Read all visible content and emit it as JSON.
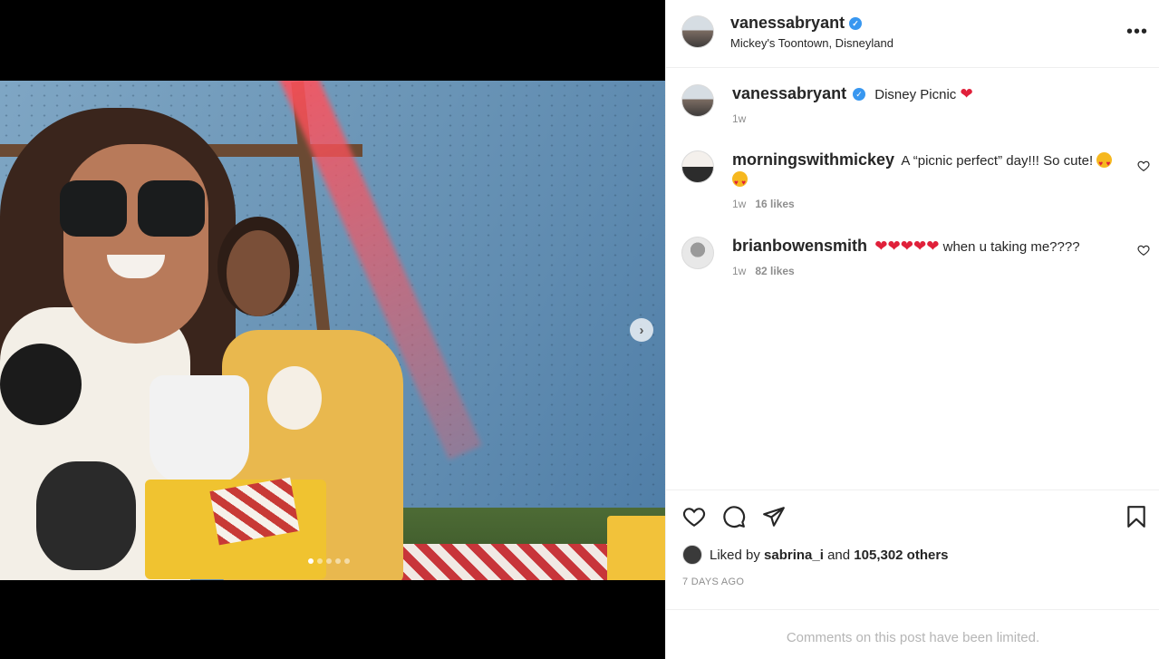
{
  "post": {
    "username": "vanessabryant",
    "location": "Mickey's Toontown, Disneyland",
    "carousel": {
      "dots": 5,
      "active_index": 0
    }
  },
  "caption": {
    "username": "vanessabryant",
    "text": "Disney Picnic",
    "time": "1w"
  },
  "comments": [
    {
      "username": "morningswithmickey",
      "text": "A “picnic perfect” day!!! So cute!",
      "time": "1w",
      "likes": "16 likes"
    },
    {
      "username": "brianbowensmith",
      "text": "when u taking me????",
      "time": "1w",
      "likes": "82 likes"
    }
  ],
  "engagement": {
    "liked_prefix": "Liked by",
    "liked_user": "sabrina_i",
    "liked_and": "and",
    "liked_others": "105,302 others",
    "posted_ago": "7 DAYS AGO"
  },
  "footer": {
    "limited_text": "Comments on this post have been limited."
  },
  "icons": {
    "more": "more-horizontal-icon",
    "like": "heart-outline-icon",
    "comment": "comment-bubble-icon",
    "share": "paper-plane-icon",
    "save": "bookmark-icon",
    "next": "chevron-right-icon"
  },
  "colors": {
    "verified": "#3897f0",
    "heart_emoji": "#e0203a",
    "muted": "#8e8e8e"
  }
}
